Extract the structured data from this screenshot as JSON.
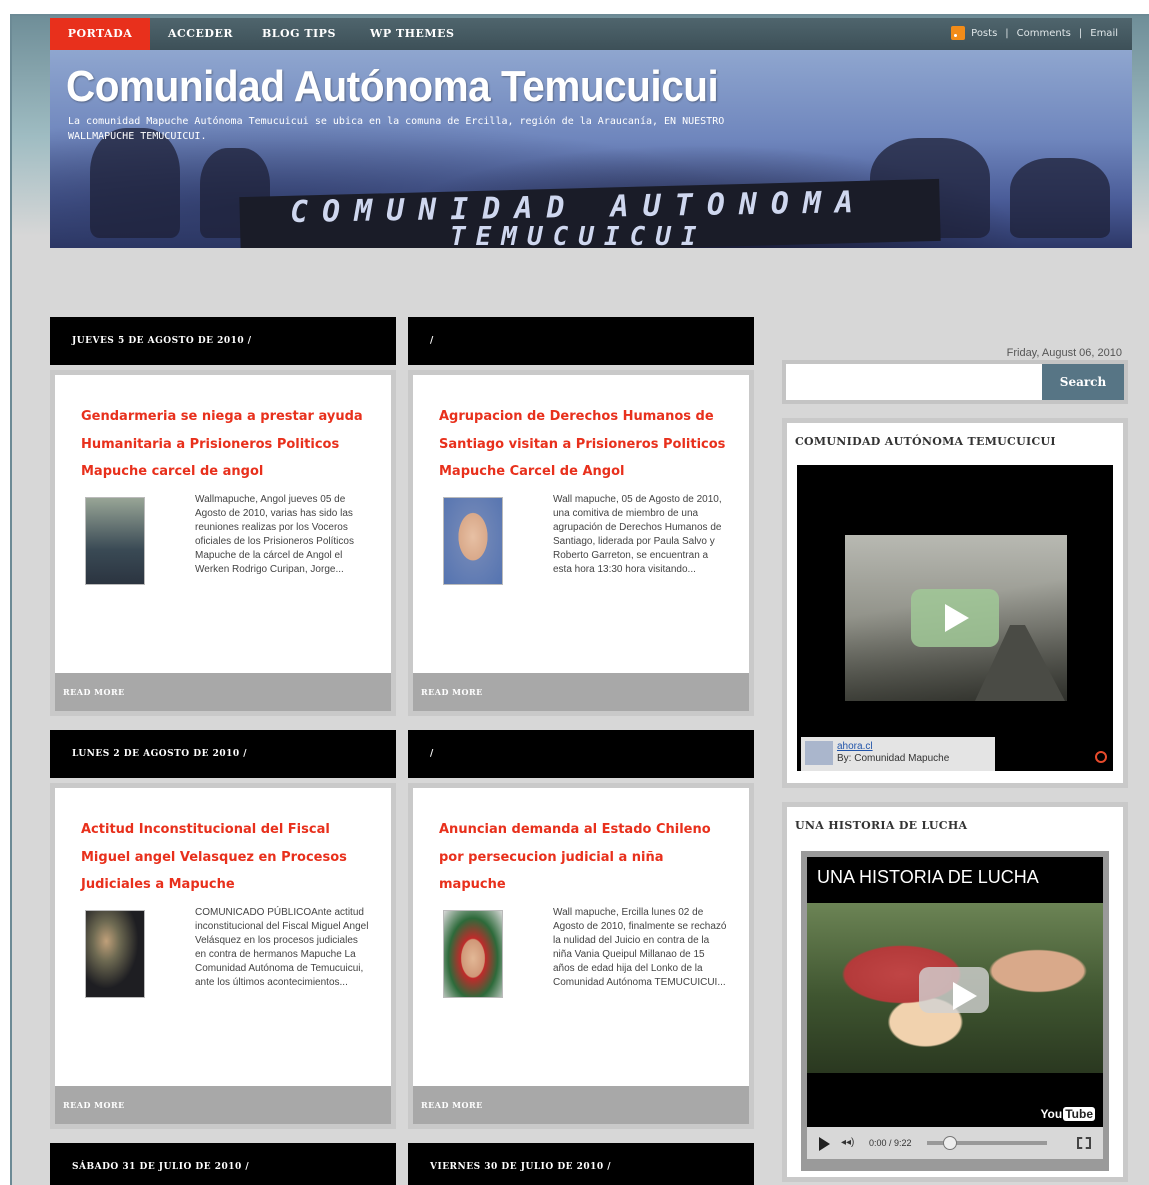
{
  "nav": {
    "items": [
      "PORTADA",
      "ACCEDER",
      "BLOG TIPS",
      "WP THEMES"
    ],
    "feeds": [
      "Posts",
      "Comments",
      "Email"
    ],
    "separator": "|"
  },
  "header": {
    "title": "Comunidad Autónoma Temucuicui",
    "description": "La comunidad Mapuche Autónoma Temucuicui se ubica en la comuna de Ercilla, región de la Araucanía, EN NUESTRO WALLMAPUCHE TEMUCUICUI.",
    "banner_line1": "COMUNIDAD AUTONOMA",
    "banner_line2": "TEMUCUICUI"
  },
  "posts": [
    {
      "date": "JUEVES 5 DE AGOSTO DE 2010 /",
      "title": "Gendarmeria se niega a prestar ayuda Humanitaria a Prisioneros Politicos Mapuche carcel de angol",
      "excerpt": "Wallmapuche, Angol jueves 05 de Agosto de 2010, varias has sido las reuniones realizas por los Voceros oficiales de los Prisioneros Políticos Mapuche de la cárcel de Angol el Werken Rodrigo Curipan, Jorge...",
      "read_more": "READ MORE"
    },
    {
      "date": "/",
      "title": "Agrupacion de Derechos Humanos de Santiago visitan a Prisioneros Politicos Mapuche Carcel de Angol",
      "excerpt": "Wall mapuche, 05 de Agosto de 2010, una comitiva de miembro de una agrupación de Derechos Humanos de Santiago, liderada por Paula Salvo y Roberto Garreton, se encuentran a esta hora 13:30 hora visitando...",
      "read_more": "READ MORE"
    },
    {
      "date": "LUNES 2 DE AGOSTO DE 2010 /",
      "title": "Actitud Inconstitucional del Fiscal Miguel angel Velasquez en Procesos Judiciales a Mapuche",
      "excerpt": "COMUNICADO PÚBLICOAnte actitud inconstitucional del Fiscal Miguel Angel Velásquez en los procesos judiciales en contra de hermanos Mapuche La Comunidad Autónoma de Temucuicui, ante los últimos acontecimientos...",
      "read_more": "READ MORE"
    },
    {
      "date": "/",
      "title": "Anuncian demanda al Estado Chileno por persecucion judicial a niña mapuche",
      "excerpt": "Wall mapuche, Ercilla lunes 02 de Agosto de 2010, finalmente se rechazó la nulidad del Juicio en contra de la niña Vania Queipul Millanao de 15 años de edad hija del Lonko de la Comunidad Autónoma TEMUCUICUI...",
      "read_more": "READ MORE"
    },
    {
      "date": "SÁBADO 31 DE JULIO DE 2010 /"
    },
    {
      "date": "VIERNES 30 DE JULIO DE 2010 /"
    }
  ],
  "sidebar": {
    "date": "Friday, August 06, 2010",
    "search_button": "Search",
    "search_placeholder": "",
    "widget1": {
      "title": "COMUNIDAD AUTÓNOMA TEMUCUICUI",
      "video_link": "ahora.cl",
      "video_by": "By: Comunidad Mapuche"
    },
    "widget2": {
      "title": "UNA HISTORIA DE LUCHA",
      "video_title": "UNA HISTORIA DE LUCHA",
      "time": "0:00 / 9:22",
      "brand_you": "You",
      "brand_tube": "Tube"
    }
  },
  "colors": {
    "accent": "#e8301c",
    "nav_bg": "#45595f",
    "search_button": "#577585",
    "post_title": "#e8301c"
  }
}
